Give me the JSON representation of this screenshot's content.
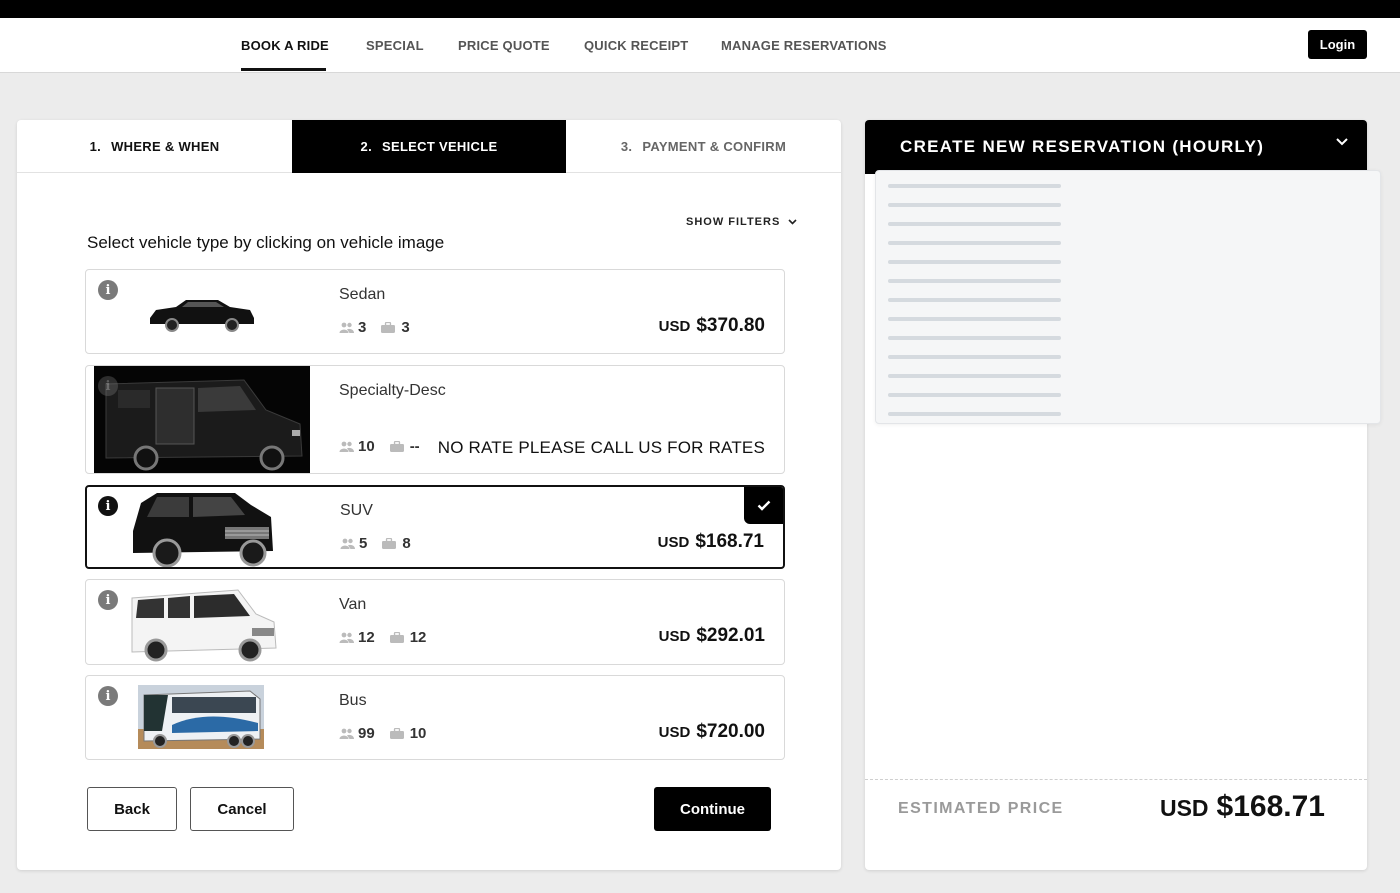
{
  "nav": {
    "items": [
      {
        "label": "BOOK A RIDE",
        "active": true
      },
      {
        "label": "SPECIAL",
        "active": false
      },
      {
        "label": "PRICE QUOTE",
        "active": false
      },
      {
        "label": "QUICK RECEIPT",
        "active": false
      },
      {
        "label": "MANAGE RESERVATIONS",
        "active": false
      }
    ],
    "login_label": "Login"
  },
  "steps": [
    {
      "num": "1.",
      "label": "WHERE & WHEN",
      "state": "completed"
    },
    {
      "num": "2.",
      "label": "SELECT VEHICLE",
      "state": "active"
    },
    {
      "num": "3.",
      "label": "PAYMENT & CONFIRM",
      "state": "upcoming"
    }
  ],
  "filters_label": "SHOW FILTERS",
  "instruction": "Select vehicle type by clicking on vehicle image",
  "vehicles": [
    {
      "name": "Sedan",
      "passengers": "3",
      "luggage": "3",
      "currency": "USD",
      "price": "$370.80",
      "selected": false
    },
    {
      "name": "Specialty-Desc",
      "passengers": "10",
      "luggage": "--",
      "note": "NO RATE PLEASE CALL US FOR RATES",
      "selected": false
    },
    {
      "name": "SUV",
      "passengers": "5",
      "luggage": "8",
      "currency": "USD",
      "price": "$168.71",
      "selected": true
    },
    {
      "name": "Van",
      "passengers": "12",
      "luggage": "12",
      "currency": "USD",
      "price": "$292.01",
      "selected": false
    },
    {
      "name": "Bus",
      "passengers": "99",
      "luggage": "10",
      "currency": "USD",
      "price": "$720.00",
      "selected": false
    }
  ],
  "actions": {
    "back": "Back",
    "cancel": "Cancel",
    "continue": "Continue"
  },
  "summary": {
    "title": "CREATE NEW RESERVATION (HOURLY)",
    "estimated_label": "ESTIMATED PRICE",
    "currency": "USD",
    "estimated_price": "$168.71"
  },
  "colors": {
    "primary": "#000000",
    "muted": "#9a9a9a",
    "background": "#ececec"
  }
}
